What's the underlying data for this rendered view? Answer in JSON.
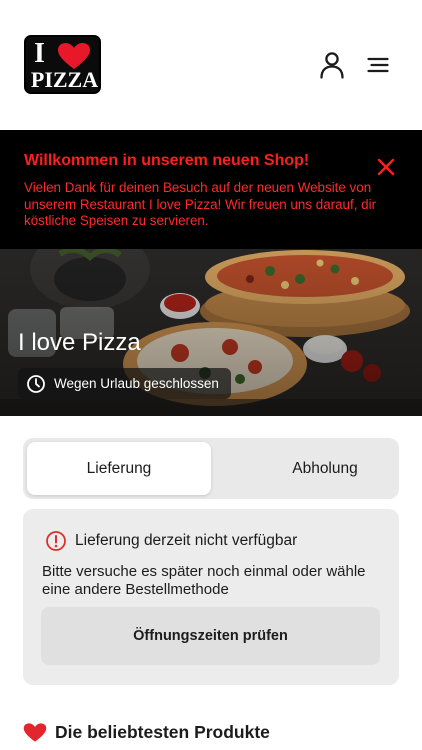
{
  "header": {
    "logo": {
      "line1": "I",
      "line2": "PIZZA",
      "heart_color": "#e8182a"
    },
    "user_icon": "user-icon",
    "menu_icon": "hamburger-menu-icon"
  },
  "banner": {
    "title": "Willkommen in unserem neuen Shop!",
    "message": "Vielen Dank für deinen Besuch auf der neuen Website von unserem Restaurant I love Pizza! Wir freuen uns darauf, dir köstliche Speisen zu servieren.",
    "close_icon": "close-icon",
    "text_color": "#ff1e1e",
    "background": "#000000"
  },
  "hero": {
    "restaurant_name": "I love Pizza",
    "status": "Wegen Urlaub geschlossen",
    "status_icon": "clock-icon"
  },
  "order_mode": {
    "options": [
      "Lieferung",
      "Abholung"
    ],
    "selected": "Lieferung"
  },
  "notice": {
    "icon": "info-circle-icon",
    "title": "Lieferung derzeit nicht verfügbar",
    "body": "Bitte versuche es später noch einmal oder wähle eine andere Bestellmethode",
    "button_label": "Öffnungszeiten prüfen",
    "accent": "#d9322a"
  },
  "popular": {
    "icon": "heart-icon",
    "title": "Die beliebtesten Produkte"
  }
}
